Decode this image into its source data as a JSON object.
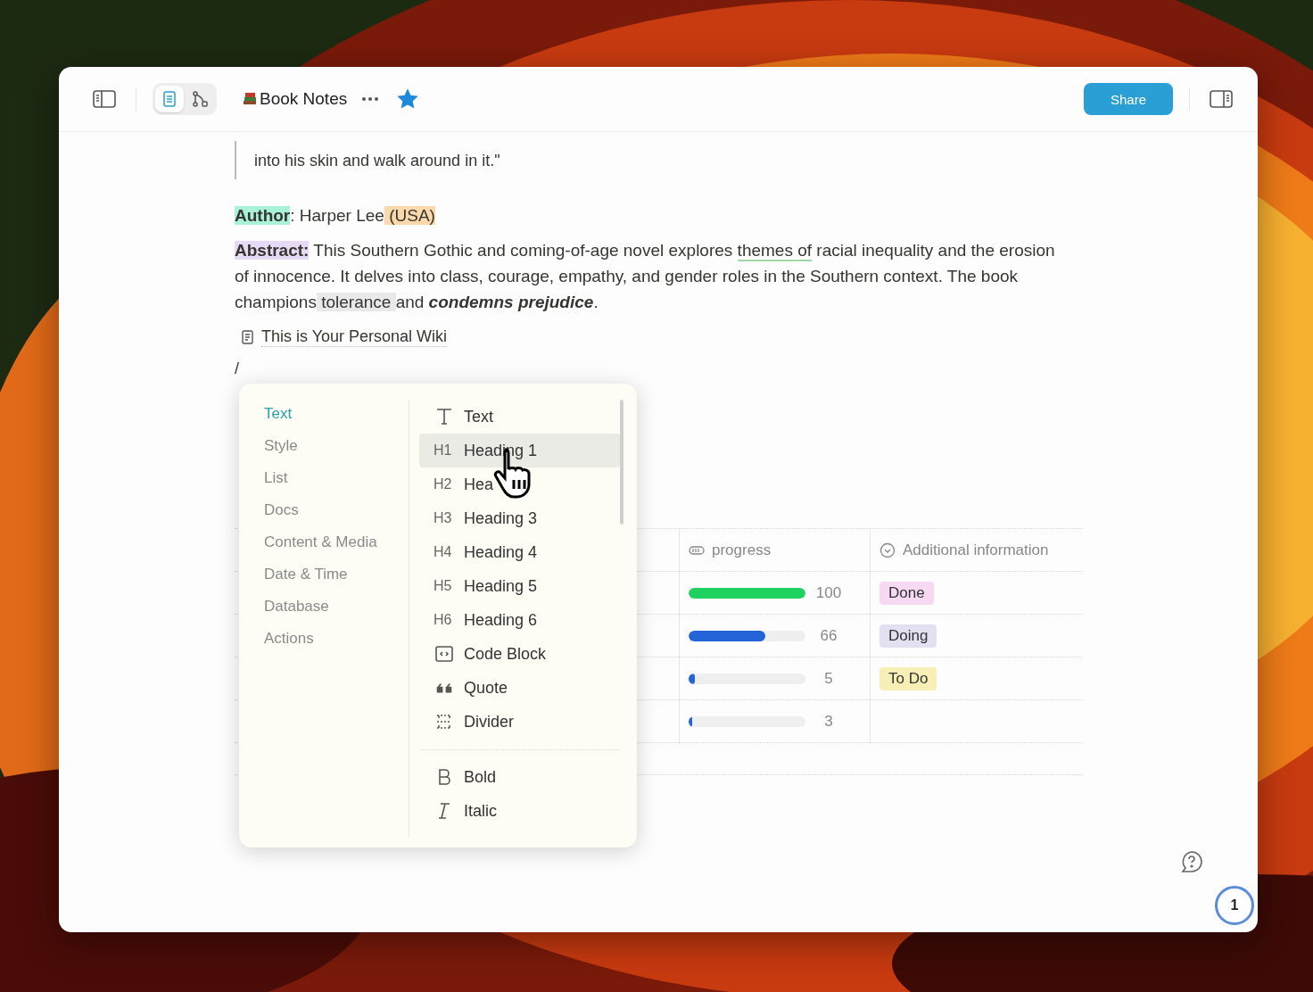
{
  "toolbar": {
    "views": [
      {
        "kind": "document",
        "selected": true
      },
      {
        "kind": "graph",
        "selected": false
      }
    ],
    "title": "Book Notes",
    "starred": true,
    "share_label": "Share"
  },
  "quote": "into his skin and walk around in it.\"",
  "paragraphs": [
    [
      {
        "text": "**Author**",
        "color": "#a8f3d8"
      },
      {
        "text": ": Harper Lee"
      },
      {
        "text": " (USA)",
        "color": "#fbd9ad"
      }
    ],
    [
      {
        "text": "**Abstract:**",
        "color": "#e6daf7"
      },
      {
        "text": " This Southern Gothic and coming-of-age novel explores "
      },
      {
        "text": "themes of",
        "underline": true
      },
      {
        "text": " racial inequality and the erosion of innocence. It delves into class, courage, empathy, and gender roles in the Southern context. The book champions"
      },
      {
        "text": " tolerance ",
        "color": "#e9e9e9"
      },
      {
        "text": "and "
      },
      {
        "text": "*condemns prejudice*",
        "bold": true
      },
      {
        "text": "."
      }
    ]
  ],
  "wiki_link": "This is Your Personal Wiki",
  "slash": "/",
  "table": {
    "columns": [
      {
        "kind": "progress",
        "label": "progress"
      },
      {
        "kind": "select",
        "label": "Additional information"
      }
    ],
    "rows": [
      {
        "level": 1,
        "reading": "100",
        "complete": true,
        "status": {
          "label": "Done",
          "color": "#f7d9f4"
        }
      },
      {
        "level": 0.66,
        "reading": "66",
        "complete": false,
        "status": {
          "label": "Doing",
          "color": "#e3e1f1"
        }
      },
      {
        "level": 0.05,
        "reading": "5",
        "complete": false,
        "status": {
          "label": "To Do",
          "color": "#f7efb5"
        }
      },
      {
        "level": 0.03,
        "reading": "3",
        "complete": false
      }
    ]
  },
  "slash_menu": {
    "categories": [
      {
        "label": "Text",
        "selected": true
      },
      {
        "label": "Style",
        "selected": false
      },
      {
        "label": "List",
        "selected": false
      },
      {
        "label": "Docs",
        "selected": false
      },
      {
        "label": "Content & Media",
        "selected": false
      },
      {
        "label": "Date & Time",
        "selected": false
      },
      {
        "label": "Database",
        "selected": false
      },
      {
        "label": "Actions",
        "selected": false
      }
    ],
    "items": [
      {
        "kind": "text",
        "label": "Text",
        "selected": false
      },
      {
        "kind": "heading",
        "prefix": "H1",
        "label": "Heading 1",
        "selected": true
      },
      {
        "kind": "heading",
        "prefix": "H2",
        "label": "Hea",
        "selected": false
      },
      {
        "kind": "heading",
        "prefix": "H3",
        "label": "Heading 3",
        "selected": false
      },
      {
        "kind": "heading",
        "prefix": "H4",
        "label": "Heading 4",
        "selected": false
      },
      {
        "kind": "heading",
        "prefix": "H5",
        "label": "Heading 5",
        "selected": false
      },
      {
        "kind": "heading",
        "prefix": "H6",
        "label": "Heading 6",
        "selected": false
      },
      {
        "kind": "code",
        "label": "Code Block",
        "selected": false
      },
      {
        "kind": "quote",
        "label": "Quote",
        "selected": false
      },
      {
        "kind": "divider",
        "label": "Divider",
        "selected": false
      },
      {
        "kind": "separator"
      },
      {
        "kind": "bold",
        "label": "Bold",
        "selected": false
      },
      {
        "kind": "italic",
        "label": "Italic",
        "selected": false
      }
    ]
  },
  "notification_count": "1"
}
